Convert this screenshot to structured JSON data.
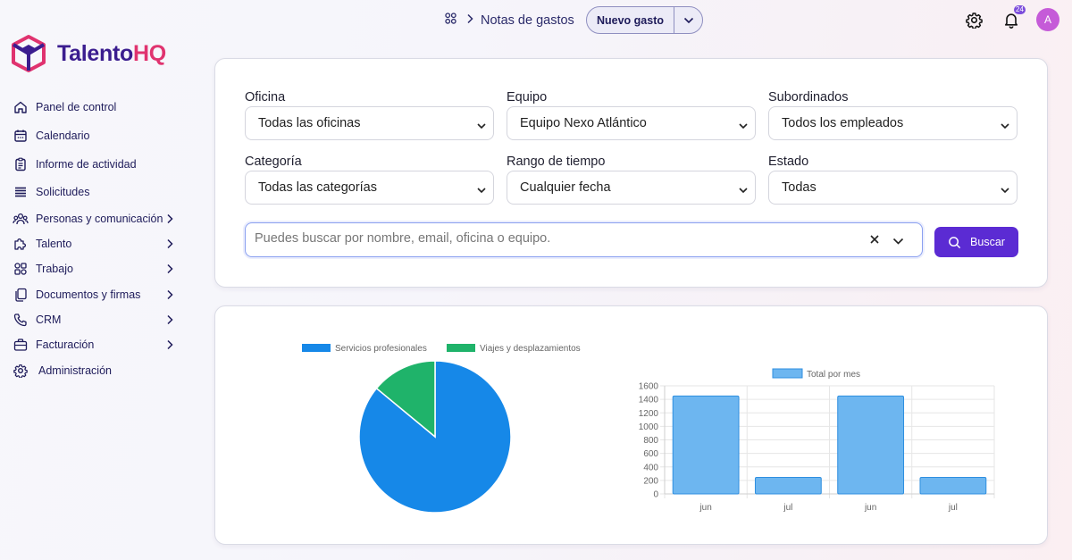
{
  "app": {
    "logo_part1": "Talento",
    "logo_part2": "HQ"
  },
  "sidebar": {
    "items": [
      {
        "label": "Panel de control",
        "icon": "home-icon"
      },
      {
        "label": "Calendario",
        "icon": "calendar-icon"
      },
      {
        "label": "Informe de actividad",
        "icon": "report-icon"
      },
      {
        "label": "Solicitudes",
        "icon": "list-icon"
      },
      {
        "label": "Personas y comunicación",
        "icon": "people-icon"
      },
      {
        "label": "Talento",
        "icon": "puzzle-icon"
      },
      {
        "label": "Trabajo",
        "icon": "grid-icon"
      },
      {
        "label": "Documentos y firmas",
        "icon": "documents-icon"
      },
      {
        "label": "CRM",
        "icon": "phone-icon"
      },
      {
        "label": "Facturación",
        "icon": "briefcase-icon"
      },
      {
        "label": "Administración",
        "icon": "gear-icon"
      }
    ]
  },
  "header": {
    "breadcrumb_title": "Notas de gastos",
    "new_button_label": "Nuevo gasto",
    "notification_count": "24",
    "avatar_initial": "A"
  },
  "filters": {
    "office": {
      "label": "Oficina",
      "value": "Todas las oficinas"
    },
    "team": {
      "label": "Equipo",
      "value": "Equipo Nexo Atlántico"
    },
    "subordinates": {
      "label": "Subordinados",
      "value": "Todos los empleados"
    },
    "category": {
      "label": "Categoría",
      "value": "Todas las categorías"
    },
    "time_range": {
      "label": "Rango de tiempo",
      "value": "Cualquier fecha"
    },
    "status": {
      "label": "Estado",
      "value": "Todas"
    },
    "search_placeholder": "Puedes buscar por nombre, email, oficina o equipo.",
    "search_button_label": "Buscar"
  },
  "colors": {
    "accent": "#5b2bd3",
    "pie_blue": "#1688e8",
    "pie_green": "#1fb36a",
    "bar_fill": "#6db6f0",
    "bar_border": "#2f8fe0"
  },
  "chart_data": [
    {
      "type": "pie",
      "categories": [
        "Servicios profesionales",
        "Viajes y desplazamientos"
      ],
      "values": [
        86,
        14
      ],
      "legend": "top"
    },
    {
      "type": "bar",
      "categories": [
        "jun",
        "jul",
        "jun",
        "jul"
      ],
      "series": [
        {
          "name": "Total por mes",
          "values": [
            1450,
            245,
            1450,
            245
          ]
        }
      ],
      "yticks": [
        "0",
        "200",
        "400",
        "600",
        "800",
        "1000",
        "1200",
        "1400",
        "1600"
      ],
      "ylim": [
        0,
        1600
      ],
      "grid": true,
      "legend": "top"
    }
  ]
}
